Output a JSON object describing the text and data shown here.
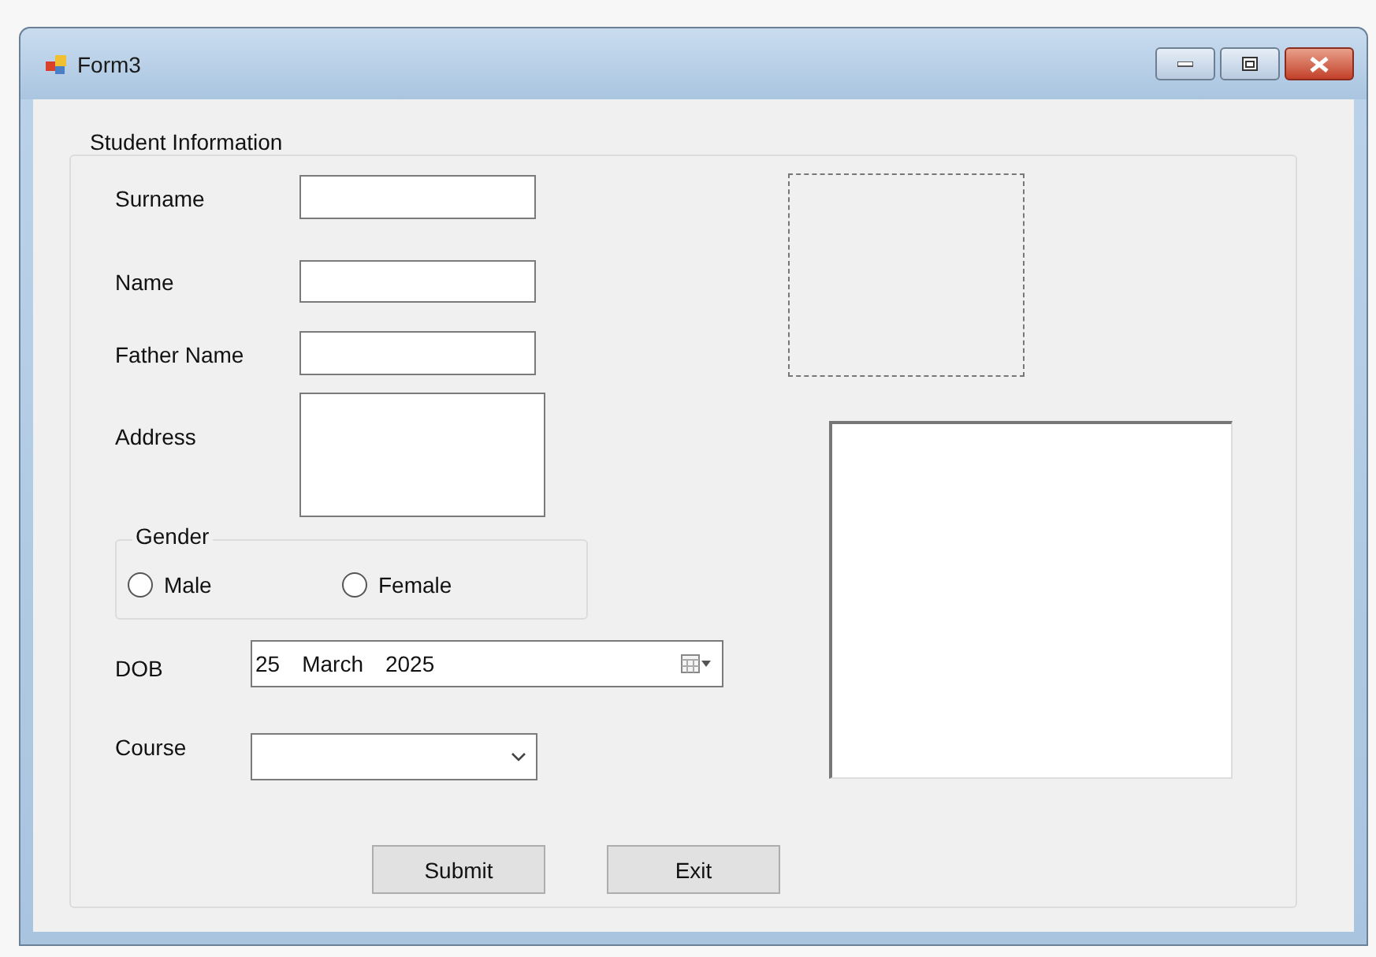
{
  "window": {
    "title": "Form3"
  },
  "group": {
    "title": "Student Information"
  },
  "fields": [
    {
      "label": "Surname",
      "kind": "text"
    },
    {
      "label": "Name",
      "kind": "text"
    },
    {
      "label": "Father Name",
      "kind": "text"
    },
    {
      "label": "Address",
      "kind": "multiline"
    }
  ],
  "gender": {
    "title": "Gender",
    "options": [
      {
        "label": "Male",
        "selected": false
      },
      {
        "label": "Female",
        "selected": false
      }
    ]
  },
  "dob": {
    "label": "DOB",
    "day": "25",
    "month": "March",
    "year": "2025"
  },
  "course": {
    "label": "Course"
  },
  "buttons": [
    "Submit",
    "Exit"
  ]
}
